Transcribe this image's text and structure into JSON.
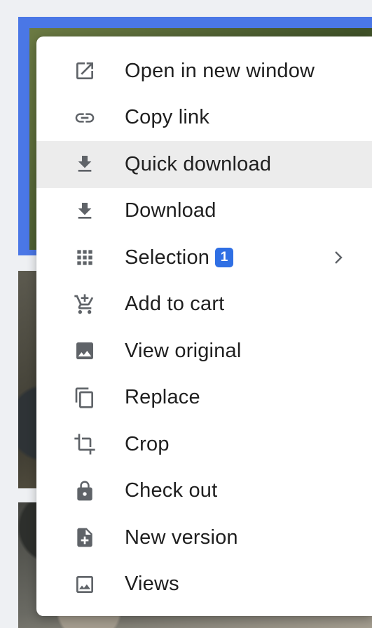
{
  "menu": {
    "items": [
      {
        "label": "Open in new window",
        "icon": "open-in-new-icon"
      },
      {
        "label": "Copy link",
        "icon": "link-icon"
      },
      {
        "label": "Quick download",
        "icon": "download-icon",
        "active": true
      },
      {
        "label": "Download",
        "icon": "download-icon"
      },
      {
        "label": "Selection",
        "icon": "grid-apps-icon",
        "badge": "1",
        "has_submenu": true
      },
      {
        "label": "Add to cart",
        "icon": "add-to-cart-icon"
      },
      {
        "label": "View original",
        "icon": "image-icon"
      },
      {
        "label": "Replace",
        "icon": "copy-icon"
      },
      {
        "label": "Crop",
        "icon": "crop-icon"
      },
      {
        "label": "Check out",
        "icon": "lock-icon"
      },
      {
        "label": "New version",
        "icon": "file-add-icon"
      },
      {
        "label": "Views",
        "icon": "image-outline-icon"
      }
    ]
  },
  "colors": {
    "accent": "#2f6fe4",
    "selection_border": "#4a77e6",
    "hover_bg": "#ececec",
    "icon": "#5f6368"
  }
}
